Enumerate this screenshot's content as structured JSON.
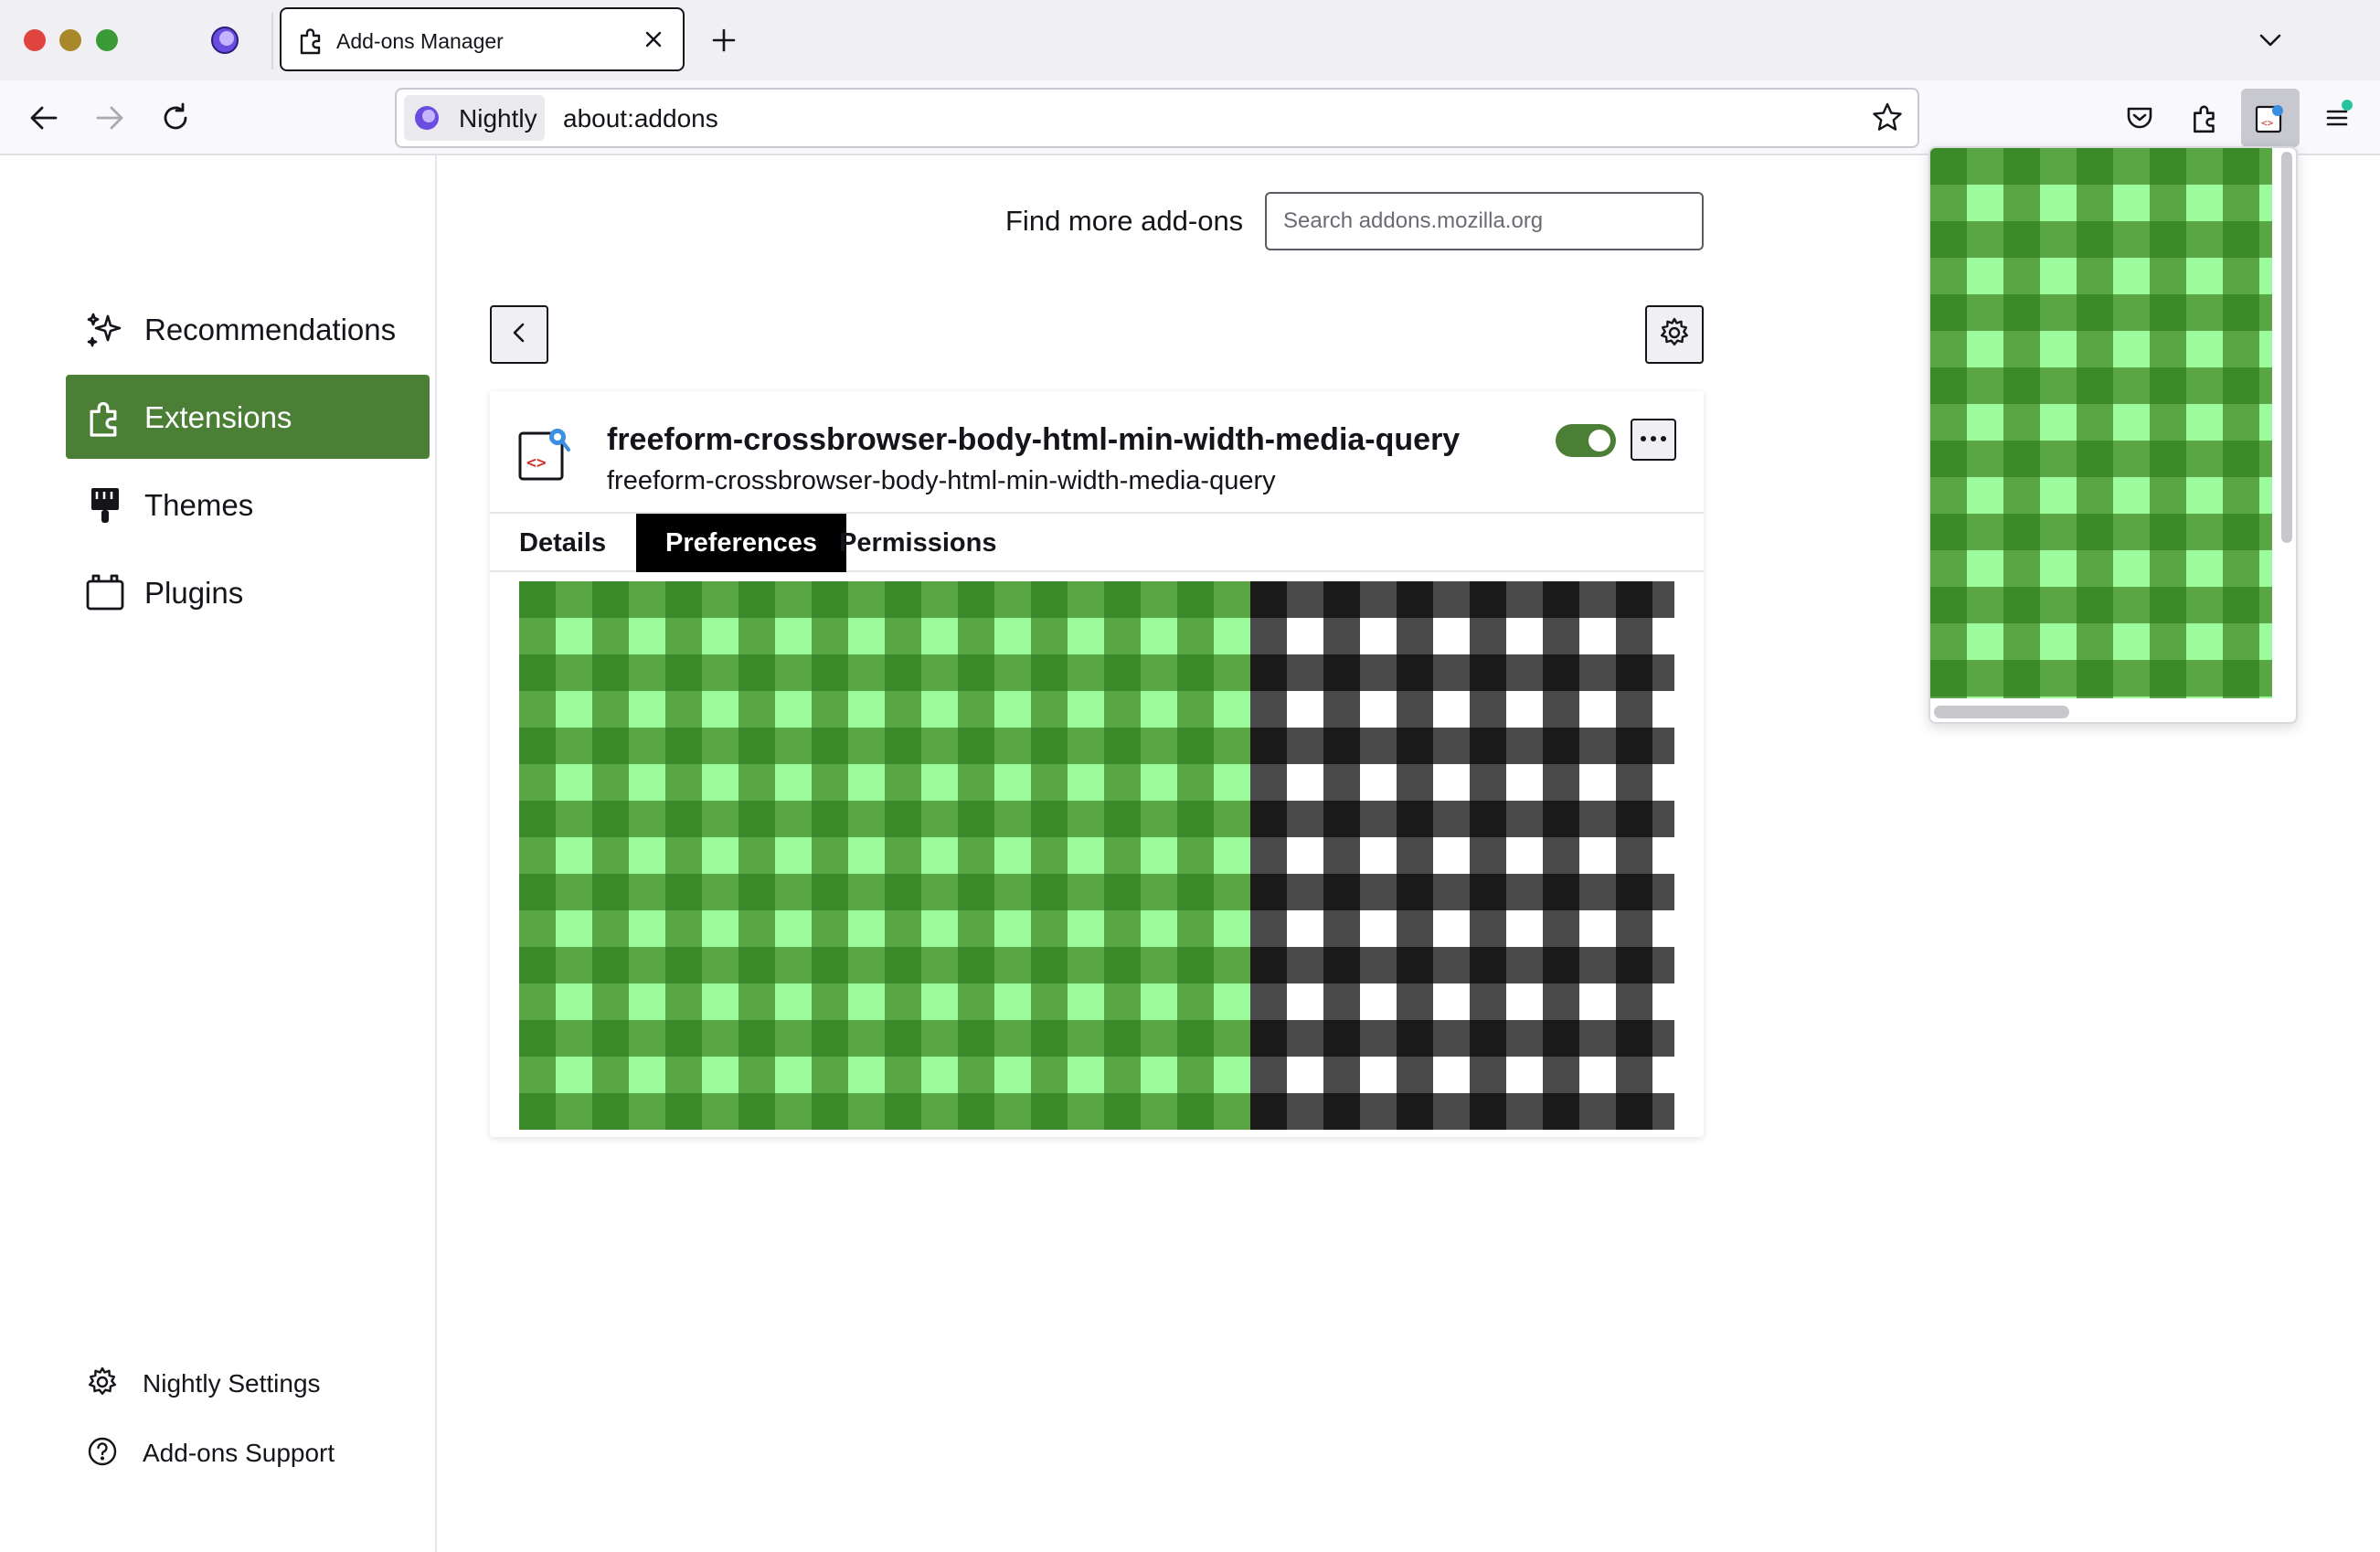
{
  "window": {
    "controls": [
      "close",
      "minimize",
      "zoom"
    ],
    "active_tab_title": "Add-ons Manager",
    "pinned_tab_icon": "nightly-logo-icon",
    "new_tab_icon": "plus-icon",
    "tab_list_icon": "chevron-down-icon"
  },
  "navbar": {
    "identity_label": "Nightly",
    "url": "about:addons",
    "icons": [
      "back-arrow-icon",
      "forward-arrow-icon",
      "reload-icon",
      "bookmark-star-icon",
      "pocket-icon",
      "extensions-puzzle-icon",
      "extension-action-icon",
      "hamburger-menu-icon"
    ]
  },
  "sidebar": {
    "categories": [
      {
        "label": "Recommendations",
        "icon": "sparkle-icon",
        "selected": false
      },
      {
        "label": "Extensions",
        "icon": "puzzle-icon",
        "selected": true
      },
      {
        "label": "Themes",
        "icon": "paintbrush-icon",
        "selected": false
      },
      {
        "label": "Plugins",
        "icon": "plugin-icon",
        "selected": false
      }
    ],
    "footer": {
      "settings_label": "Nightly Settings",
      "support_label": "Add-ons Support"
    }
  },
  "main": {
    "find_more_label": "Find more add-ons",
    "search_placeholder": "Search addons.mozilla.org",
    "extension": {
      "name": "freeform-crossbrowser-body-html-min-width-media-query",
      "description": "freeform-crossbrowser-body-html-min-width-media-query",
      "enabled": true
    },
    "tabs": [
      {
        "label": "Details",
        "active": false
      },
      {
        "label": "Preferences",
        "active": true
      },
      {
        "label": "Permissions",
        "active": false
      }
    ]
  },
  "colors": {
    "accent": "#4c7f36",
    "check_green_dark": "#3a8a2a",
    "check_green_mid": "#5aa645",
    "check_green_light": "#9cfb9c",
    "check_black": "#1a1a1a",
    "check_gray": "#4a4a4a",
    "check_white": "#ffffff"
  }
}
